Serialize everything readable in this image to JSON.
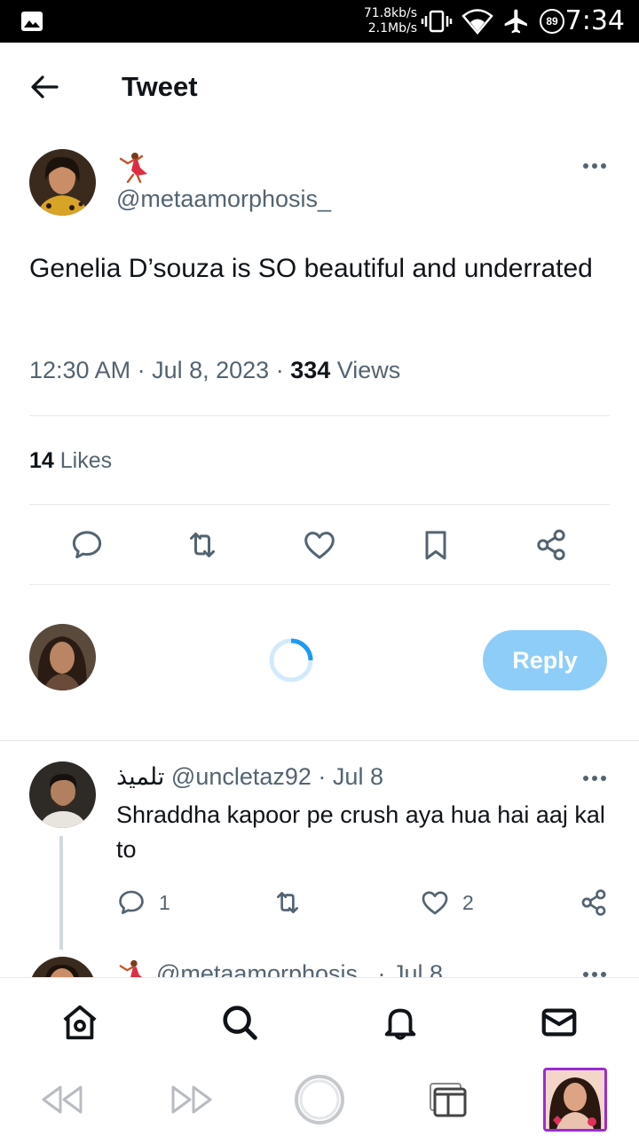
{
  "status_bar": {
    "net_up": "71.8kb/s",
    "net_down": "2.1Mb/s",
    "battery": "89",
    "time": "7:34"
  },
  "header": {
    "title": "Tweet"
  },
  "tweet": {
    "author_emoji": "💃",
    "handle": "@metaamorphosis_",
    "text": "Genelia D’souza is SO beautiful and underrated",
    "time": "12:30 AM",
    "date": "Jul 8, 2023",
    "views_count": "334",
    "views_label": "Views",
    "likes_count": "14",
    "likes_label": "Likes"
  },
  "composer": {
    "reply_label": "Reply"
  },
  "replies": [
    {
      "name": "تلمیذ",
      "handle": "@uncletaz92",
      "date": "Jul 8",
      "text": "Shraddha kapoor pe crush aya hua hai aaj kal to",
      "reply_count": "1",
      "like_count": "2"
    }
  ],
  "partial_tweet": {
    "emoji": "💃",
    "handle": "@metaamorphosis_",
    "date": "Jul 8"
  },
  "colors": {
    "accent": "#1d9bf0",
    "reply_button": "#8ecdf8",
    "secondary_text": "#536471"
  }
}
